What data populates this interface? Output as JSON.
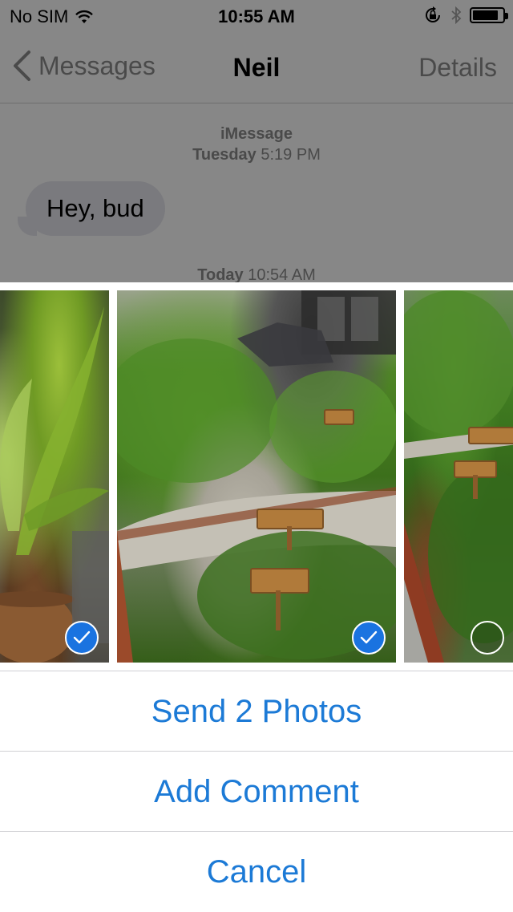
{
  "status_bar": {
    "carrier": "No SIM",
    "time": "10:55 AM",
    "battery_level": 0.85
  },
  "nav": {
    "back_label": "Messages",
    "title": "Neil",
    "details_label": "Details"
  },
  "thread": {
    "service": "iMessage",
    "first_day": "Tuesday",
    "first_time": "5:19 PM",
    "message_text": "Hey, bud",
    "second_day": "Today",
    "second_time": "10:54 AM"
  },
  "photos": [
    {
      "name": "photo-plant",
      "selected": true
    },
    {
      "name": "photo-garden",
      "selected": true
    },
    {
      "name": "photo-garden-side",
      "selected": false
    }
  ],
  "actions": {
    "send_label": "Send 2 Photos",
    "comment_label": "Add Comment",
    "cancel_label": "Cancel"
  },
  "colors": {
    "accent": "#1c7ad6",
    "check_selected": "#1a73e0",
    "dim_overlay": "#878787"
  },
  "icons": {
    "wifi": "wifi-icon",
    "rotation_lock": "rotation-lock-icon",
    "bluetooth": "bluetooth-icon",
    "battery": "battery-icon",
    "back": "chevron-left-icon",
    "checkmark": "checkmark-icon"
  }
}
